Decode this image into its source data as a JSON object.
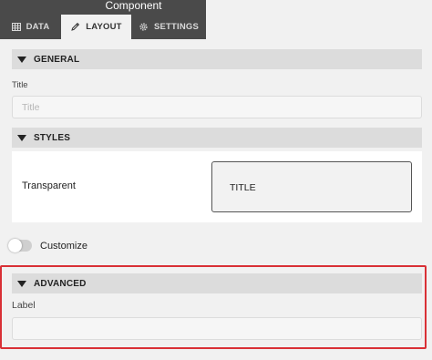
{
  "panel": {
    "title": "Component",
    "tabs": [
      {
        "label": "DATA",
        "icon": "table-icon"
      },
      {
        "label": "LAYOUT",
        "icon": "pencil-icon",
        "active": true
      },
      {
        "label": "SETTINGS",
        "icon": "gear-icon"
      }
    ]
  },
  "general": {
    "header": "GENERAL",
    "title_label": "Title",
    "title_placeholder": "Title",
    "title_value": ""
  },
  "styles": {
    "header": "STYLES",
    "option_label": "Transparent",
    "preview_text": "TITLE"
  },
  "customize": {
    "label": "Customize",
    "enabled": false
  },
  "advanced": {
    "header": "ADVANCED",
    "label_label": "Label",
    "label_value": "",
    "highlight_color": "#d93036"
  }
}
